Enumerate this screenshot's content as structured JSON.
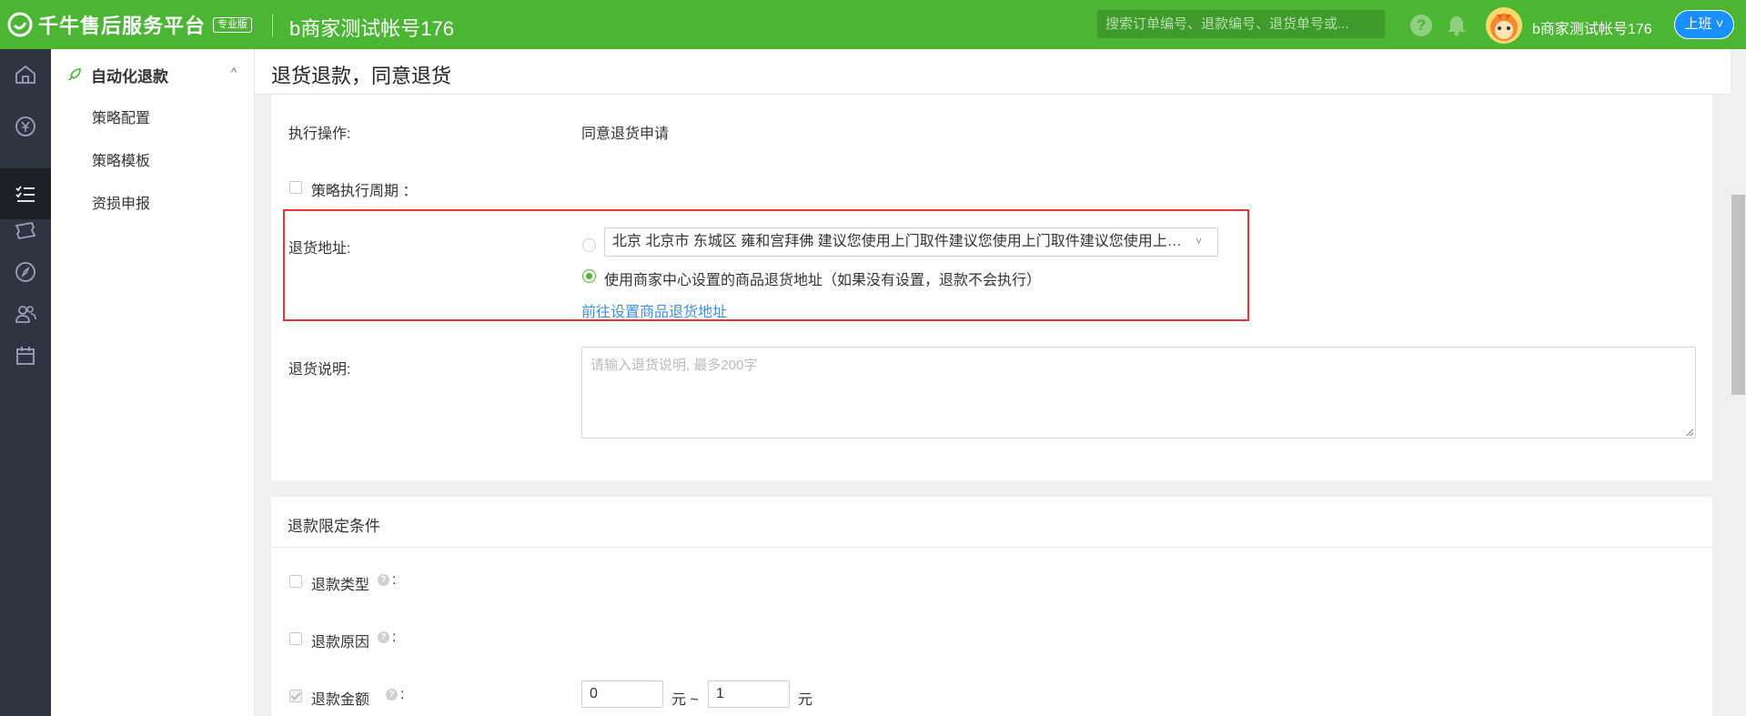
{
  "topbar": {
    "brand": "千牛售后服务平台",
    "edition": "专业版",
    "account_title": "b商家测试帐号176",
    "search_placeholder": "搜索订单编号、退款编号、退货单号或...",
    "help_icon": "question-circle-icon",
    "bell_icon": "bell-icon",
    "username": "b商家测试帐号176",
    "status_button": "上班"
  },
  "rail": {
    "items": [
      "home-icon",
      "yuan-coin-icon",
      "rocket-icon",
      "list-checks-icon",
      "ticket-icon",
      "compass-icon",
      "users-icon",
      "calendar-icon"
    ],
    "active_index": 3
  },
  "subnav": {
    "title": "自动化退款",
    "items": [
      {
        "label": "策略配置"
      },
      {
        "label": "策略模板"
      },
      {
        "label": "资损申报"
      }
    ]
  },
  "page": {
    "title": "退货退款，同意退货"
  },
  "form": {
    "action_label": "执行操作:",
    "action_value": "同意退货申请",
    "period_label": "策略执行周期 ：",
    "address_label": "退货地址:",
    "address_select_value": "北京 北京市 东城区 雍和宫拜佛 建议您使用上门取件建议您使用上门取件建议您使用上门取件",
    "address_option2": "使用商家中心设置的商品退货地址（如果没有设置，退款不会执行）",
    "address_option_selected": 2,
    "address_link": "前往设置商品退货地址",
    "return_note_label": "退货说明:",
    "return_note_placeholder": "请输入退货说明, 最多200字"
  },
  "conditions": {
    "title": "退款限定条件",
    "refund_type_label": "退款类型",
    "refund_reason_label": "退款原因",
    "refund_amount_label": "退款金额",
    "colon": ":",
    "amount_min": "0",
    "amount_max": "1",
    "unit_between": "元 ~",
    "unit_end": "元"
  }
}
